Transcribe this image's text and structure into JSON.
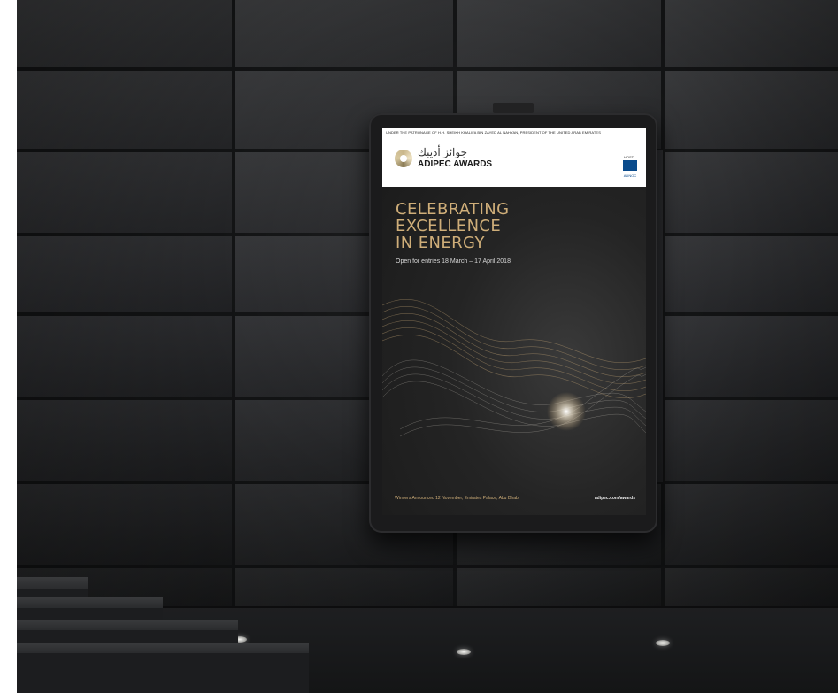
{
  "poster": {
    "patronage": "UNDER THE PATRONAGE OF H.H. SHEIKH KHALIFA BIN ZAYED AL NAHYAN, PRESIDENT OF THE UNITED ARAB EMIRATES",
    "arabic_name": "جوائز أديبك",
    "awards_name": "ADIPEC AWARDS",
    "host_label": "HOST",
    "host_name": "ADNOC",
    "headline": [
      "CELEBRATING",
      "EXCELLENCE",
      "IN ENERGY"
    ],
    "entries": "Open for entries 18 March – 17 April 2018",
    "footer_left": "Winners Announced 12 November, Emirates Palace, Abu Dhabi",
    "footer_right": "adipec.com/awards"
  },
  "colors": {
    "headline_gold": "#cfae79",
    "poster_dark": "#1a1a1a",
    "wall": "#2e2f31",
    "host_blue": "#0a4b8c"
  }
}
